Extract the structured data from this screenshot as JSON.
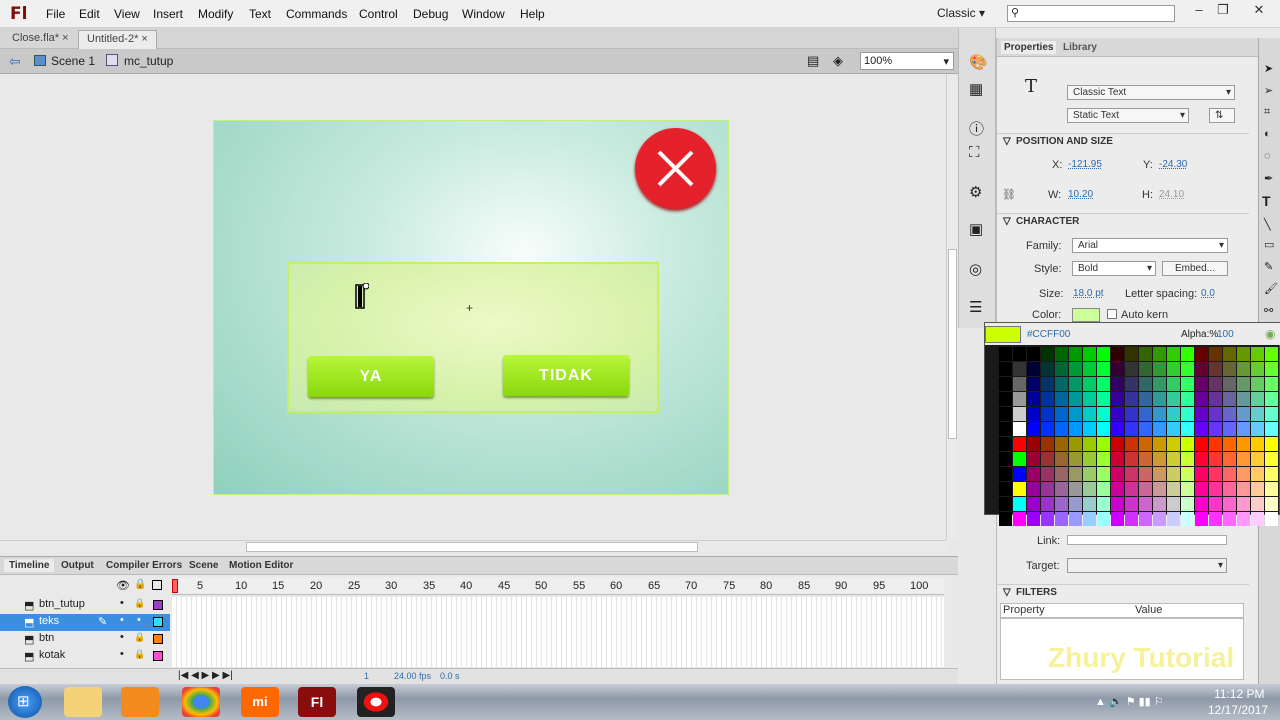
{
  "menubar": {
    "logo": "Fl",
    "items": [
      "File",
      "Edit",
      "View",
      "Insert",
      "Modify",
      "Text",
      "Commands",
      "Control",
      "Debug",
      "Window",
      "Help"
    ],
    "workspace": "Classic",
    "search_placeholder": ""
  },
  "doc_tabs": [
    "Close.fla*",
    "Untitled-2*"
  ],
  "breadcrumb": {
    "scene": "Scene 1",
    "symbol": "mc_tutup",
    "zoom": "100%"
  },
  "stage": {
    "yes_label": "YA",
    "no_label": "TIDAK"
  },
  "panels": [
    "Timeline",
    "Output",
    "Compiler Errors",
    "Scene",
    "Motion Editor"
  ],
  "timeline": {
    "ruler": [
      "5",
      "10",
      "15",
      "20",
      "25",
      "30",
      "35",
      "40",
      "45",
      "50",
      "55",
      "60",
      "65",
      "70",
      "75",
      "80",
      "85",
      "90",
      "95",
      "100"
    ],
    "layers": [
      {
        "name": "btn_tutup",
        "color": "#9b3fc8"
      },
      {
        "name": "teks",
        "color": "#2fe0f5",
        "selected": true
      },
      {
        "name": "btn",
        "color": "#ff7f00"
      },
      {
        "name": "kotak",
        "color": "#ff4dd9"
      }
    ],
    "status": {
      "frame": "1",
      "fps": "24.00 fps",
      "time": "0.0 s"
    }
  },
  "properties": {
    "tabs": [
      "Properties",
      "Library"
    ],
    "text_engine": "Classic Text",
    "text_type": "Static Text",
    "pos_section": "POSITION AND SIZE",
    "x_label": "X:",
    "x": "-121.95",
    "y_label": "Y:",
    "y": "-24.30",
    "w_label": "W:",
    "w": "10.20",
    "h_label": "H:",
    "h": "24.10",
    "char_section": "CHARACTER",
    "family_label": "Family:",
    "family": "Arial",
    "style_label": "Style:",
    "style": "Bold",
    "embed": "Embed...",
    "size_label": "Size:",
    "size": "18.0 pt",
    "spacing_label": "Letter spacing:",
    "spacing": "0.0",
    "color_label": "Color:",
    "autokern": "Auto kern",
    "link_label": "Link:",
    "target_label": "Target:",
    "filters_section": "FILTERS",
    "col_property": "Property",
    "col_value": "Value"
  },
  "swatch": {
    "hex": "#CCFF00",
    "alpha_label": "Alpha:%",
    "alpha": "100",
    "current": "#ccff00"
  },
  "taskbar": {
    "time": "11:12 PM",
    "date": "12/17/2017"
  },
  "watermark": "Zhury Tutorial"
}
